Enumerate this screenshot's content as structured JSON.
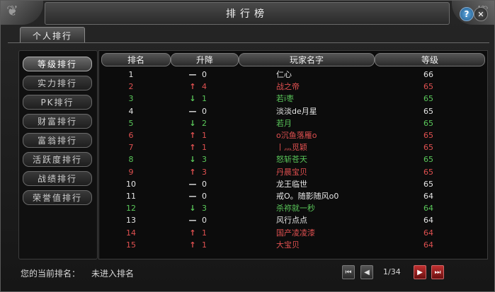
{
  "window": {
    "title": "排行榜",
    "help_label": "?",
    "close_label": "✕"
  },
  "tab": {
    "label": "个人排行"
  },
  "categories": [
    {
      "label": "等级排行",
      "active": true
    },
    {
      "label": "实力排行",
      "active": false
    },
    {
      "label": "PK排行",
      "active": false
    },
    {
      "label": "财富排行",
      "active": false
    },
    {
      "label": "富翁排行",
      "active": false
    },
    {
      "label": "活跃度排行",
      "active": false
    },
    {
      "label": "战绩排行",
      "active": false
    },
    {
      "label": "荣誉值排行",
      "active": false
    }
  ],
  "table": {
    "headers": {
      "rank": "排名",
      "trend": "升降",
      "name": "玩家名字",
      "level": "等级"
    },
    "colors": {
      "white": "#e6e6e6",
      "red": "#e05050",
      "green": "#5ac85a"
    },
    "rows": [
      {
        "rank": "1",
        "trend": "same",
        "change": "0",
        "name": "仁心",
        "level": "66",
        "color": "white"
      },
      {
        "rank": "2",
        "trend": "up",
        "change": "4",
        "name": "战之帝",
        "level": "65",
        "color": "red"
      },
      {
        "rank": "3",
        "trend": "down",
        "change": "1",
        "name": "若і枣",
        "level": "65",
        "color": "green"
      },
      {
        "rank": "4",
        "trend": "same",
        "change": "0",
        "name": "淡淡de月星",
        "level": "65",
        "color": "white"
      },
      {
        "rank": "5",
        "trend": "down",
        "change": "2",
        "name": "若月",
        "level": "65",
        "color": "green"
      },
      {
        "rank": "6",
        "trend": "up",
        "change": "1",
        "name": "o沉鱼落雁o",
        "level": "65",
        "color": "red"
      },
      {
        "rank": "7",
        "trend": "up",
        "change": "1",
        "name": "丨灬觅颖",
        "level": "65",
        "color": "red"
      },
      {
        "rank": "8",
        "trend": "down",
        "change": "3",
        "name": "怒斩苍天",
        "level": "65",
        "color": "green"
      },
      {
        "rank": "9",
        "trend": "up",
        "change": "3",
        "name": "丹晨宝贝",
        "level": "65",
        "color": "red"
      },
      {
        "rank": "10",
        "trend": "same",
        "change": "0",
        "name": "龙王临世",
        "level": "65",
        "color": "white"
      },
      {
        "rank": "11",
        "trend": "same",
        "change": "0",
        "name": "戒O。随影随风o0",
        "level": "64",
        "color": "white"
      },
      {
        "rank": "12",
        "trend": "down",
        "change": "3",
        "name": "杀祢就一秒",
        "level": "64",
        "color": "green"
      },
      {
        "rank": "13",
        "trend": "same",
        "change": "0",
        "name": "风行点点",
        "level": "64",
        "color": "white"
      },
      {
        "rank": "14",
        "trend": "up",
        "change": "1",
        "name": "国产凌凌漆",
        "level": "64",
        "color": "red"
      },
      {
        "rank": "15",
        "trend": "up",
        "change": "1",
        "name": "大宝贝",
        "level": "64",
        "color": "red"
      }
    ]
  },
  "trend_icons": {
    "up": "↑",
    "down": "↓",
    "same": "—"
  },
  "status": {
    "label": "您的当前排名：",
    "value": "未进入排名"
  },
  "pagination": {
    "indicator": "1/34",
    "first_icon": "⏮",
    "prev_icon": "◀",
    "next_icon": "▶",
    "last_icon": "⏭"
  }
}
